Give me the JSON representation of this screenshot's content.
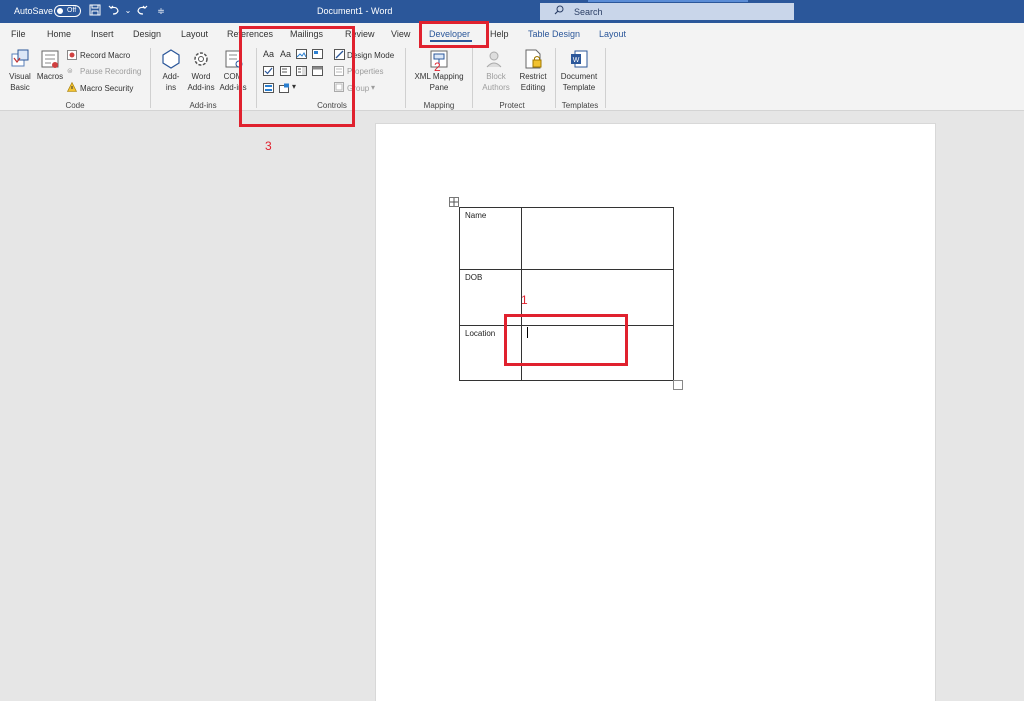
{
  "titlebar": {
    "autosave_label": "AutoSave",
    "toggle_state": "Off",
    "document_title": "Document1  -  Word",
    "search_placeholder": "Search"
  },
  "tabs": [
    {
      "label": "File"
    },
    {
      "label": "Home"
    },
    {
      "label": "Insert"
    },
    {
      "label": "Design"
    },
    {
      "label": "Layout"
    },
    {
      "label": "References"
    },
    {
      "label": "Mailings"
    },
    {
      "label": "Review"
    },
    {
      "label": "View"
    },
    {
      "label": "Developer"
    },
    {
      "label": "Help"
    },
    {
      "label": "Table Design"
    },
    {
      "label": "Layout"
    }
  ],
  "ribbon": {
    "code": {
      "label": "Code",
      "visual_basic": "Visual Basic",
      "macros": "Macros",
      "record_macro": "Record Macro",
      "pause_recording": "Pause Recording",
      "macro_security": "Macro Security"
    },
    "addins": {
      "label": "Add-ins",
      "addins": "Add-ins",
      "word_addins": "Word Add-ins",
      "com_addins": "COM Add-ins"
    },
    "controls": {
      "label": "Controls",
      "design_mode": "Design Mode",
      "properties": "Properties",
      "group": "Group"
    },
    "mapping": {
      "label": "Mapping",
      "xml_mapping_pane": "XML Mapping Pane"
    },
    "protect": {
      "label": "Protect",
      "block_authors": "Block Authors",
      "restrict_editing": "Restrict Editing"
    },
    "templates": {
      "label": "Templates",
      "document_template": "Document Template"
    }
  },
  "document": {
    "rows": [
      {
        "label": "Name",
        "value": ""
      },
      {
        "label": "DOB",
        "value": ""
      },
      {
        "label": "Location",
        "value": ""
      }
    ]
  },
  "annotations": [
    "1",
    "2",
    "3"
  ],
  "colors": {
    "accent": "#2b579a",
    "annotation": "#e0212e"
  }
}
